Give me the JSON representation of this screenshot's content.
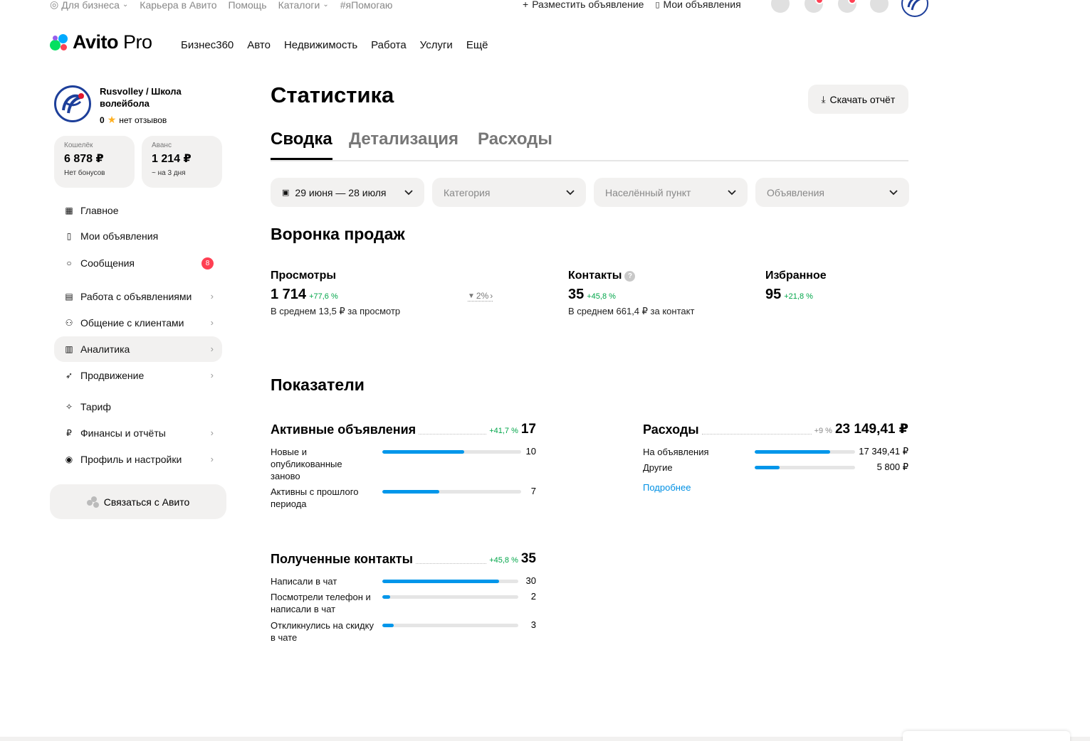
{
  "topbar": {
    "business": "Для бизнеса",
    "career": "Карьера в Авито",
    "help": "Помощь",
    "catalogs": "Каталоги",
    "ihelp": "#яПомогаю",
    "post_ad": "Разместить объявление",
    "my_ads": "Мои объявления"
  },
  "logo": {
    "brand": "Avito",
    "suffix": "Pro"
  },
  "nav": [
    "Бизнес360",
    "Авто",
    "Недвижимость",
    "Работа",
    "Услуги",
    "Ещё"
  ],
  "profile": {
    "name": "Rusvolley / Школа волейбола",
    "rating": "0",
    "reviews": "нет отзывов"
  },
  "wallets": [
    {
      "label": "Кошелёк",
      "value": "6 878 ₽",
      "sub": "Нет бонусов"
    },
    {
      "label": "Аванс",
      "value": "1 214 ₽",
      "sub": "~ на 3 дня"
    }
  ],
  "sidebar": {
    "items": [
      {
        "label": "Главное",
        "icon": "grid-icon"
      },
      {
        "label": "Мои объявления",
        "icon": "ads-icon"
      },
      {
        "label": "Сообщения",
        "icon": "chat-icon",
        "badge": "8"
      },
      {
        "label": "Работа с объявлениями",
        "icon": "listing-icon"
      },
      {
        "label": "Общение с клиентами",
        "icon": "people-icon"
      },
      {
        "label": "Аналитика",
        "icon": "chart-icon"
      },
      {
        "label": "Продвижение",
        "icon": "rocket-icon"
      },
      {
        "label": "Тариф",
        "icon": "tariff-icon"
      },
      {
        "label": "Финансы и отчёты",
        "icon": "ruble-icon"
      },
      {
        "label": "Профиль и настройки",
        "icon": "profile-icon"
      }
    ],
    "contact": "Связаться с Авито"
  },
  "main": {
    "title": "Статистика",
    "download": "Скачать отчёт",
    "tabs": [
      "Сводка",
      "Детализация",
      "Расходы"
    ],
    "filters": {
      "date": "29 июня — 28 июля",
      "category": "Категория",
      "city": "Населённый пункт",
      "ads": "Объявления"
    },
    "funnel": {
      "title": "Воронка продаж",
      "views": {
        "title": "Просмотры",
        "value": "1 714",
        "delta": "+77,6 %",
        "sub": "В среднем 13,5 ₽ за просмотр"
      },
      "conversion": "2%",
      "contacts": {
        "title": "Контакты",
        "value": "35",
        "delta": "+45,8 %",
        "sub": "В среднем 661,4 ₽ за контакт",
        "help": "?"
      },
      "favorites": {
        "title": "Избранное",
        "value": "95",
        "delta": "+21,8 %"
      }
    },
    "indicators": {
      "title": "Показатели",
      "active": {
        "title": "Активные объявления",
        "delta": "+41,7 %",
        "value": "17",
        "rows": [
          {
            "label": "Новые и опубликованные заново",
            "value": "10",
            "fraction": 0.59
          },
          {
            "label": "Активны с прошлого периода",
            "value": "7",
            "fraction": 0.41
          }
        ]
      },
      "expenses": {
        "title": "Расходы",
        "delta": "+9 %",
        "value": "23 149,41 ₽",
        "rows": [
          {
            "label": "На объявления",
            "value": "17 349,41 ₽",
            "fraction": 0.75
          },
          {
            "label": "Другие",
            "value": "5 800 ₽",
            "fraction": 0.25
          }
        ],
        "more": "Подробнее"
      },
      "contacts": {
        "title": "Полученные контакты",
        "delta": "+45,8 %",
        "value": "35",
        "rows": [
          {
            "label": "Написали в чат",
            "value": "30",
            "fraction": 0.86
          },
          {
            "label": "Посмотрели телефон и написали в чат",
            "value": "2",
            "fraction": 0.057
          },
          {
            "label": "Откликнулись на скидку в чате",
            "value": "3",
            "fraction": 0.086
          }
        ]
      }
    }
  },
  "colors": {
    "accent": "#0096ea",
    "positive": "#02a64a",
    "badge": "#ff4053",
    "surface": "#f2f1f0"
  }
}
